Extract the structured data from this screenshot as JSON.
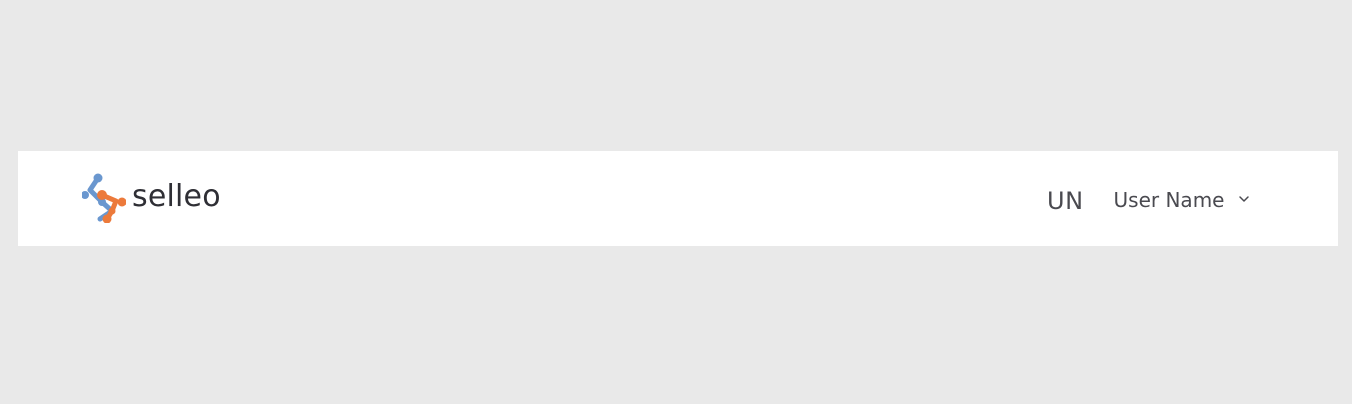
{
  "header": {
    "brand": {
      "name": "selleo",
      "icon": "selleo-logo-icon",
      "colors": {
        "blue": "#6a97cf",
        "orange": "#ec7a3b",
        "text": "#2f2f35"
      }
    },
    "user": {
      "initials": "UN",
      "name": "User Name",
      "menu_icon": "chevron-down-icon"
    }
  },
  "colors": {
    "page_background": "#e9e9e9",
    "header_background": "#ffffff",
    "text": "#4a4a50"
  }
}
